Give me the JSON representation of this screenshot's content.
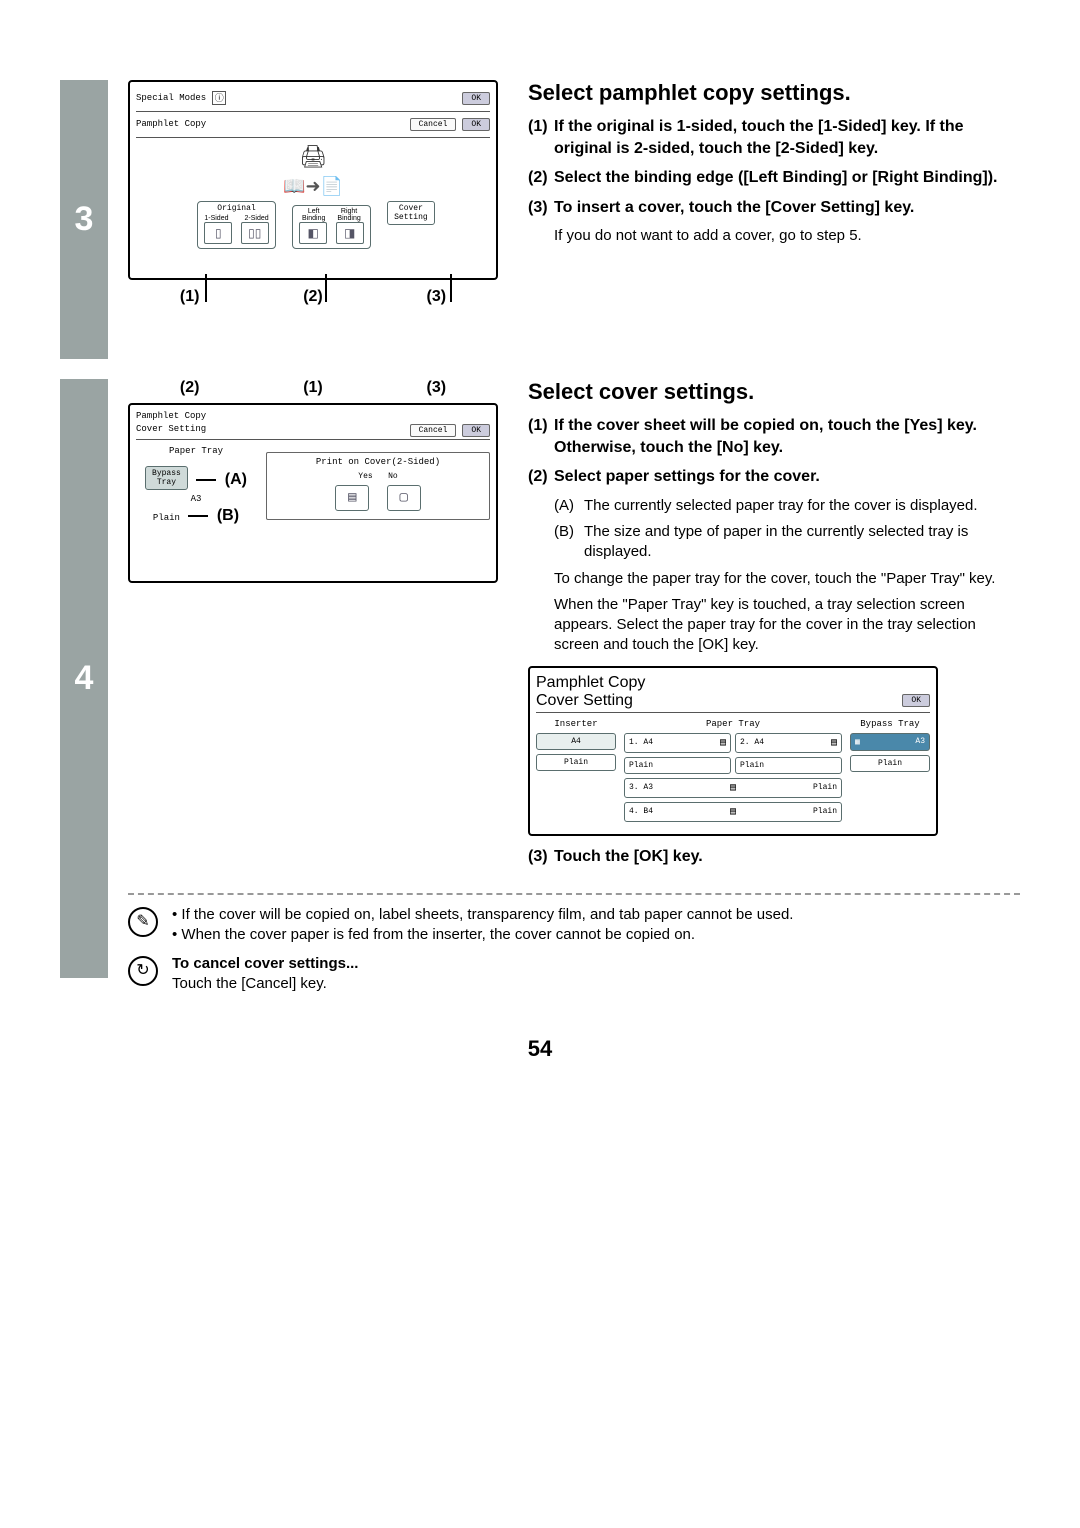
{
  "page_number": "54",
  "step3": {
    "number": "3",
    "fig": {
      "row_header": "Special Modes",
      "btn_ok": "OK",
      "row_sub": "Pamphlet Copy",
      "btn_cancel": "Cancel",
      "btn_ok2": "OK",
      "group_original": {
        "caption": "Original",
        "a": "1-Sided",
        "b": "2-Sided"
      },
      "group_binding_left": "Left\nBinding",
      "group_binding_right": "Right\nBinding",
      "cover_setting": "Cover\nSetting",
      "callouts": [
        "(1)",
        "(2)",
        "(3)"
      ]
    },
    "title": "Select pamphlet copy settings.",
    "items": [
      "If the original is 1-sided, touch the [1-Sided] key. If the original is 2-sided, touch the [2-Sided] key.",
      "Select the binding edge ([Left Binding] or [Right Binding]).",
      "To insert a cover, touch the [Cover Setting] key."
    ],
    "sub": "If you do not want to add a cover, go to step 5."
  },
  "step4": {
    "number": "4",
    "fig_top_callouts": [
      "(2)",
      "(1)",
      "(3)"
    ],
    "fig": {
      "row_header": "Pamphlet Copy",
      "row_sub": "Cover Setting",
      "btn_cancel": "Cancel",
      "btn_ok": "OK",
      "inner_label": "Paper Tray",
      "print_on_cover": "Print on Cover(2-Sided)",
      "yes": "Yes",
      "no": "No",
      "bypass": "Bypass\nTray",
      "inf_a": "A3",
      "inf_b": "Plain",
      "ab_a": "(A)",
      "ab_b": "(B)"
    },
    "title": "Select cover settings.",
    "items": [
      "If the cover sheet will be copied on, touch the [Yes] key. Otherwise, touch the [No] key.",
      "Select paper settings for the cover."
    ],
    "sub_a": "(A)",
    "sub_a_txt": "The currently selected paper tray for the cover is displayed.",
    "sub_b": "(B)",
    "sub_b_txt": "The size and type of paper in the currently selected tray is displayed.",
    "para1": "To change the paper tray for the cover, touch the \"Paper Tray\" key.",
    "para2": "When the \"Paper Tray\" key is touched, a tray selection screen appears. Select the paper tray for the cover in the tray selection screen and touch the [OK] key.",
    "panel5": {
      "row_header": "Pamphlet Copy",
      "row_sub": "Cover Setting",
      "btn_ok": "OK",
      "col_inserter": "Inserter",
      "col_paper": "Paper Tray",
      "col_bypass": "Bypass Tray",
      "inserter_a": "A4",
      "inserter_b": "Plain",
      "cells": {
        "c1": "1. A4",
        "c1b": "Plain",
        "c2": "2. A4",
        "c2b": "Plain",
        "c3": "3. A3",
        "c3b": "Plain",
        "c4": "4. B4",
        "c4b": "Plain"
      },
      "bypass_a": "A3",
      "bypass_b": "Plain"
    },
    "item3": "Touch the [OK] key."
  },
  "notes": {
    "bullets": [
      "If the cover will be copied on, label sheets, transparency film, and tab paper cannot be used.",
      "When the cover paper is fed from the inserter, the cover cannot be copied on."
    ],
    "cancel_title": "To cancel cover settings...",
    "cancel_text": "Touch the [Cancel] key."
  }
}
